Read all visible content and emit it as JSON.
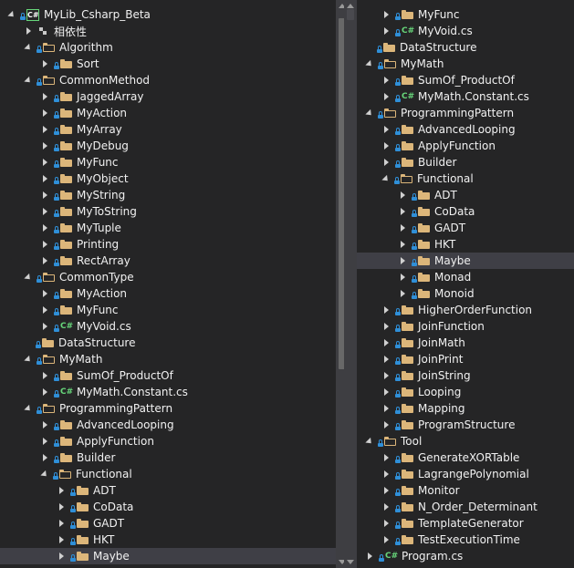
{
  "left_pane": {
    "rows": [
      {
        "label": "MyLib_Csharp_Beta",
        "icon": "csharp-project-icon",
        "expander": "expanded",
        "indent": 0
      },
      {
        "label": "相依性",
        "icon": "dependencies-icon",
        "expander": "collapsed",
        "indent": 1
      },
      {
        "label": "Algorithm",
        "icon": "folder-open-icon",
        "expander": "expanded",
        "indent": 1
      },
      {
        "label": "Sort",
        "icon": "folder-icon",
        "expander": "collapsed",
        "indent": 2
      },
      {
        "label": "CommonMethod",
        "icon": "folder-open-icon",
        "expander": "expanded",
        "indent": 1
      },
      {
        "label": "JaggedArray",
        "icon": "folder-icon",
        "expander": "collapsed",
        "indent": 2
      },
      {
        "label": "MyAction",
        "icon": "folder-icon",
        "expander": "collapsed",
        "indent": 2
      },
      {
        "label": "MyArray",
        "icon": "folder-icon",
        "expander": "collapsed",
        "indent": 2
      },
      {
        "label": "MyDebug",
        "icon": "folder-icon",
        "expander": "collapsed",
        "indent": 2
      },
      {
        "label": "MyFunc",
        "icon": "folder-icon",
        "expander": "collapsed",
        "indent": 2
      },
      {
        "label": "MyObject",
        "icon": "folder-icon",
        "expander": "collapsed",
        "indent": 2
      },
      {
        "label": "MyString",
        "icon": "folder-icon",
        "expander": "collapsed",
        "indent": 2
      },
      {
        "label": "MyToString",
        "icon": "folder-icon",
        "expander": "collapsed",
        "indent": 2
      },
      {
        "label": "MyTuple",
        "icon": "folder-icon",
        "expander": "collapsed",
        "indent": 2
      },
      {
        "label": "Printing",
        "icon": "folder-icon",
        "expander": "collapsed",
        "indent": 2
      },
      {
        "label": "RectArray",
        "icon": "folder-icon",
        "expander": "collapsed",
        "indent": 2
      },
      {
        "label": "CommonType",
        "icon": "folder-open-icon",
        "expander": "expanded",
        "indent": 1
      },
      {
        "label": "MyAction",
        "icon": "folder-icon",
        "expander": "collapsed",
        "indent": 2
      },
      {
        "label": "MyFunc",
        "icon": "folder-icon",
        "expander": "collapsed",
        "indent": 2
      },
      {
        "label": "MyVoid.cs",
        "icon": "csharp-file-icon",
        "expander": "collapsed",
        "indent": 2
      },
      {
        "label": "DataStructure",
        "icon": "folder-icon",
        "expander": "none",
        "indent": 1
      },
      {
        "label": "MyMath",
        "icon": "folder-open-icon",
        "expander": "expanded",
        "indent": 1
      },
      {
        "label": "SumOf_ProductOf",
        "icon": "folder-icon",
        "expander": "collapsed",
        "indent": 2
      },
      {
        "label": "MyMath.Constant.cs",
        "icon": "csharp-file-icon",
        "expander": "collapsed",
        "indent": 2
      },
      {
        "label": "ProgrammingPattern",
        "icon": "folder-open-icon",
        "expander": "expanded",
        "indent": 1
      },
      {
        "label": "AdvancedLooping",
        "icon": "folder-icon",
        "expander": "collapsed",
        "indent": 2
      },
      {
        "label": "ApplyFunction",
        "icon": "folder-icon",
        "expander": "collapsed",
        "indent": 2
      },
      {
        "label": "Builder",
        "icon": "folder-icon",
        "expander": "collapsed",
        "indent": 2
      },
      {
        "label": "Functional",
        "icon": "folder-open-icon",
        "expander": "expanded",
        "indent": 2
      },
      {
        "label": "ADT",
        "icon": "folder-icon",
        "expander": "collapsed",
        "indent": 3
      },
      {
        "label": "CoData",
        "icon": "folder-icon",
        "expander": "collapsed",
        "indent": 3
      },
      {
        "label": "GADT",
        "icon": "folder-icon",
        "expander": "collapsed",
        "indent": 3
      },
      {
        "label": "HKT",
        "icon": "folder-icon",
        "expander": "collapsed",
        "indent": 3
      },
      {
        "label": "Maybe",
        "icon": "folder-icon",
        "expander": "collapsed",
        "indent": 3,
        "selected": true
      }
    ]
  },
  "right_pane": {
    "rows": [
      {
        "label": "MyFunc",
        "icon": "folder-icon",
        "expander": "collapsed",
        "indent": 1
      },
      {
        "label": "MyVoid.cs",
        "icon": "csharp-file-icon",
        "expander": "collapsed",
        "indent": 1
      },
      {
        "label": "DataStructure",
        "icon": "folder-icon",
        "expander": "none",
        "indent": 0
      },
      {
        "label": "MyMath",
        "icon": "folder-open-icon",
        "expander": "expanded",
        "indent": 0
      },
      {
        "label": "SumOf_ProductOf",
        "icon": "folder-icon",
        "expander": "collapsed",
        "indent": 1
      },
      {
        "label": "MyMath.Constant.cs",
        "icon": "csharp-file-icon",
        "expander": "collapsed",
        "indent": 1
      },
      {
        "label": "ProgrammingPattern",
        "icon": "folder-open-icon",
        "expander": "expanded",
        "indent": 0
      },
      {
        "label": "AdvancedLooping",
        "icon": "folder-icon",
        "expander": "collapsed",
        "indent": 1
      },
      {
        "label": "ApplyFunction",
        "icon": "folder-icon",
        "expander": "collapsed",
        "indent": 1
      },
      {
        "label": "Builder",
        "icon": "folder-icon",
        "expander": "collapsed",
        "indent": 1
      },
      {
        "label": "Functional",
        "icon": "folder-open-icon",
        "expander": "expanded",
        "indent": 1
      },
      {
        "label": "ADT",
        "icon": "folder-icon",
        "expander": "collapsed",
        "indent": 2
      },
      {
        "label": "CoData",
        "icon": "folder-icon",
        "expander": "collapsed",
        "indent": 2
      },
      {
        "label": "GADT",
        "icon": "folder-icon",
        "expander": "collapsed",
        "indent": 2
      },
      {
        "label": "HKT",
        "icon": "folder-icon",
        "expander": "collapsed",
        "indent": 2
      },
      {
        "label": "Maybe",
        "icon": "folder-icon",
        "expander": "collapsed",
        "indent": 2,
        "selected": true
      },
      {
        "label": "Monad",
        "icon": "folder-icon",
        "expander": "collapsed",
        "indent": 2
      },
      {
        "label": "Monoid",
        "icon": "folder-icon",
        "expander": "collapsed",
        "indent": 2
      },
      {
        "label": "HigherOrderFunction",
        "icon": "folder-icon",
        "expander": "collapsed",
        "indent": 1
      },
      {
        "label": "JoinFunction",
        "icon": "folder-icon",
        "expander": "collapsed",
        "indent": 1
      },
      {
        "label": "JoinMath",
        "icon": "folder-icon",
        "expander": "collapsed",
        "indent": 1
      },
      {
        "label": "JoinPrint",
        "icon": "folder-icon",
        "expander": "collapsed",
        "indent": 1
      },
      {
        "label": "JoinString",
        "icon": "folder-icon",
        "expander": "collapsed",
        "indent": 1
      },
      {
        "label": "Looping",
        "icon": "folder-icon",
        "expander": "collapsed",
        "indent": 1
      },
      {
        "label": "Mapping",
        "icon": "folder-icon",
        "expander": "collapsed",
        "indent": 1
      },
      {
        "label": "ProgramStructure",
        "icon": "folder-icon",
        "expander": "collapsed",
        "indent": 1
      },
      {
        "label": "Tool",
        "icon": "folder-open-icon",
        "expander": "expanded",
        "indent": 0
      },
      {
        "label": "GenerateXORTable",
        "icon": "folder-icon",
        "expander": "collapsed",
        "indent": 1
      },
      {
        "label": "LagrangePolynomial",
        "icon": "folder-icon",
        "expander": "collapsed",
        "indent": 1
      },
      {
        "label": "Monitor",
        "icon": "folder-icon",
        "expander": "collapsed",
        "indent": 1
      },
      {
        "label": "N_Order_Determinant",
        "icon": "folder-icon",
        "expander": "collapsed",
        "indent": 1
      },
      {
        "label": "TemplateGenerator",
        "icon": "folder-icon",
        "expander": "collapsed",
        "indent": 1
      },
      {
        "label": "TestExecutionTime",
        "icon": "folder-icon",
        "expander": "collapsed",
        "indent": 1
      },
      {
        "label": "Program.cs",
        "icon": "csharp-file-icon",
        "expander": "collapsed",
        "indent": 0
      }
    ]
  }
}
